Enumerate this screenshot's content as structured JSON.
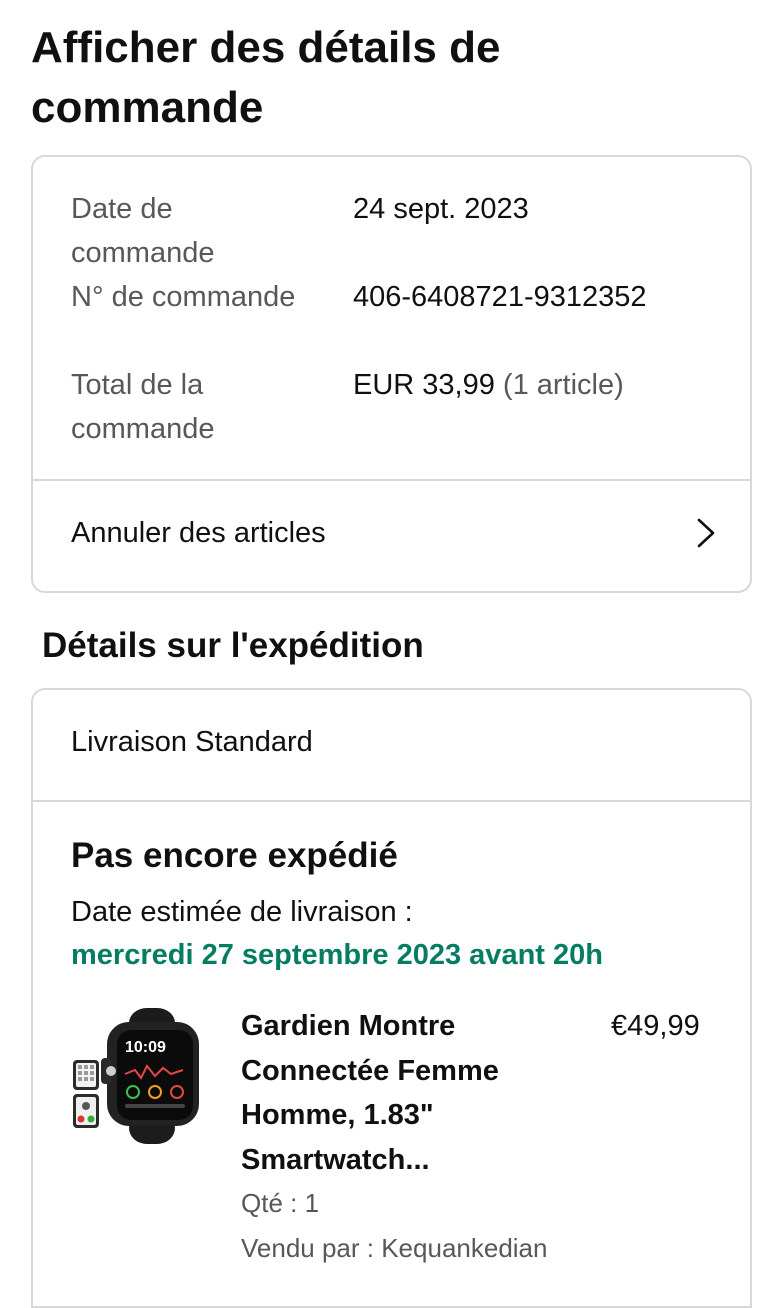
{
  "page": {
    "title": "Afficher des détails de commande"
  },
  "order": {
    "date_label": "Date de commande",
    "date_value": "24 sept. 2023",
    "number_label": "N° de commande",
    "number_value": "406-6408721-9312352",
    "total_label": "Total de la commande",
    "total_value": "EUR 33,99",
    "total_items": "(1 article)",
    "cancel_label": "Annuler des articles"
  },
  "shipping": {
    "section_title": "Détails sur l'expédition",
    "method": "Livraison Standard",
    "status": "Pas encore expédié",
    "estimate_label": "Date estimée de livraison :",
    "estimate_date": "mercredi 27 septembre 2023 avant 20h",
    "estimate_color": "#067d62"
  },
  "product": {
    "title": "Gardien Montre Connectée Femme Homme, 1.83\" Smartwatch...",
    "price": "€49,99",
    "quantity": "Qté : 1",
    "seller": "Vendu par : Kequankedian",
    "watch_time": "10:09"
  }
}
